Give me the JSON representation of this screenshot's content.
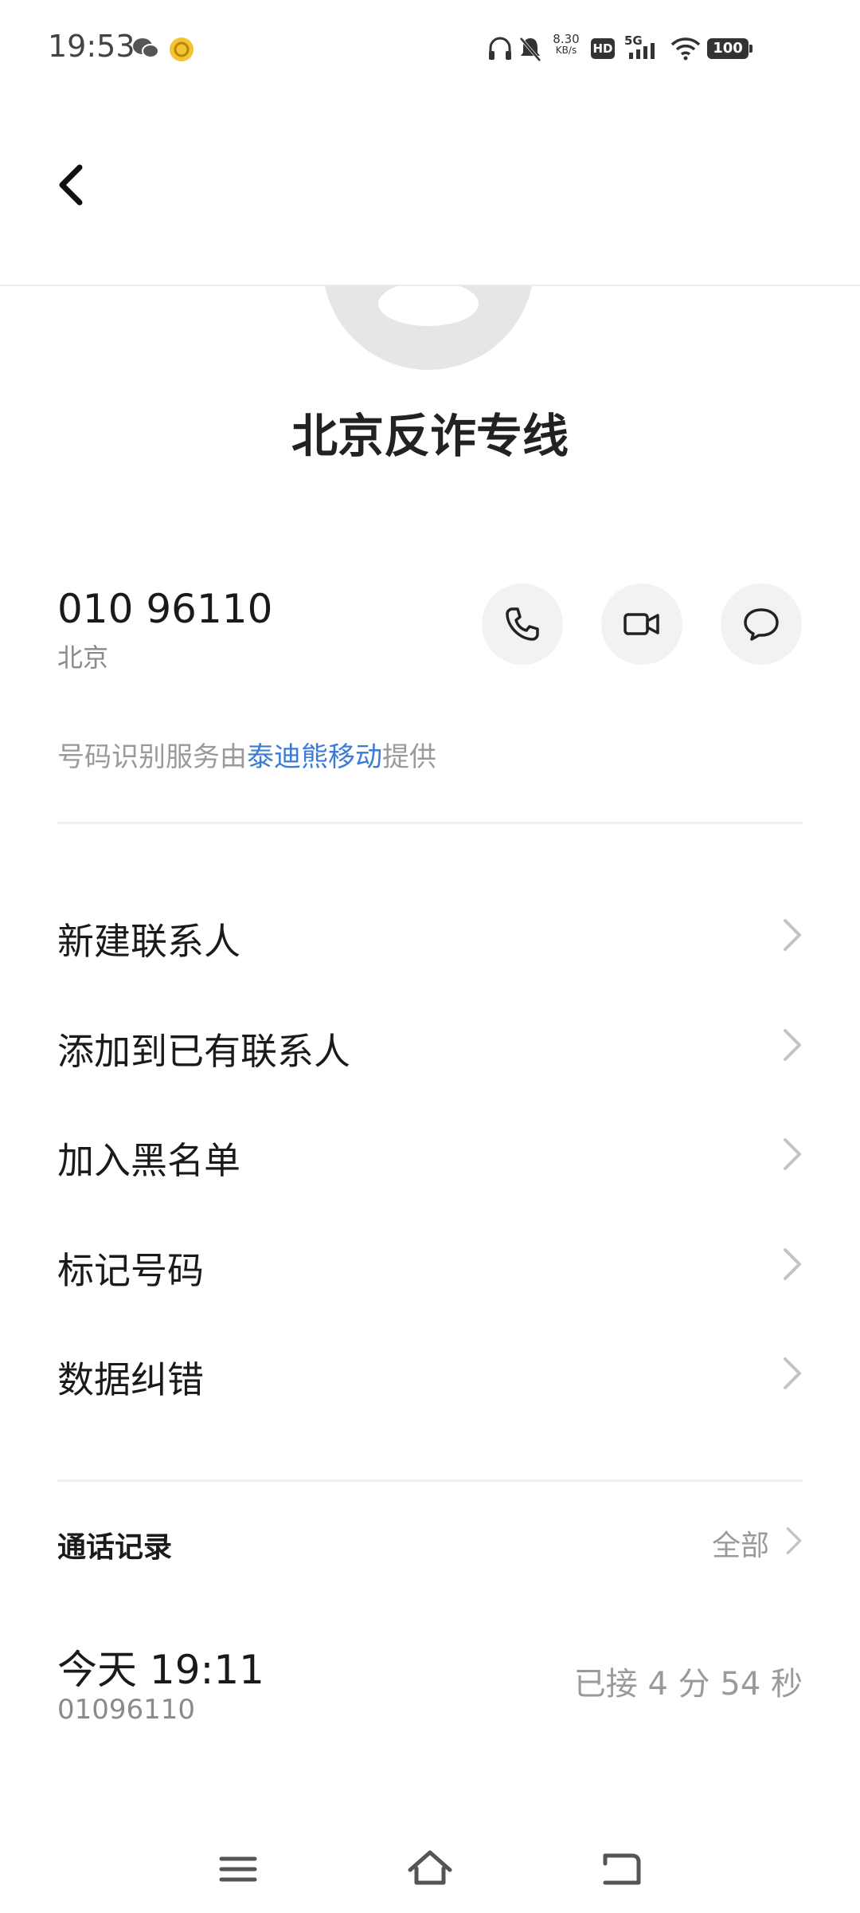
{
  "status_bar": {
    "time": "19:53",
    "net_speed_value": "8.30",
    "net_speed_unit": "KB/s",
    "hd_label": "HD",
    "signal_label": "5G",
    "battery": "100"
  },
  "contact": {
    "name": "北京反诈专线",
    "number": "010 96110",
    "location": "北京"
  },
  "provider": {
    "prefix": "号码识别服务由",
    "link": "泰迪熊移动",
    "suffix": "提供"
  },
  "menu": {
    "items": [
      {
        "label": "新建联系人"
      },
      {
        "label": "添加到已有联系人"
      },
      {
        "label": "加入黑名单"
      },
      {
        "label": "标记号码"
      },
      {
        "label": "数据纠错"
      }
    ]
  },
  "call_log": {
    "title": "通话记录",
    "all_label": "全部",
    "records": [
      {
        "time": "今天 19:11",
        "number": "01096110",
        "status": "已接 4 分 54 秒"
      }
    ]
  },
  "icons": {
    "back": "back-arrow-icon",
    "call": "phone-icon",
    "video": "video-camera-icon",
    "message": "chat-bubble-icon"
  }
}
